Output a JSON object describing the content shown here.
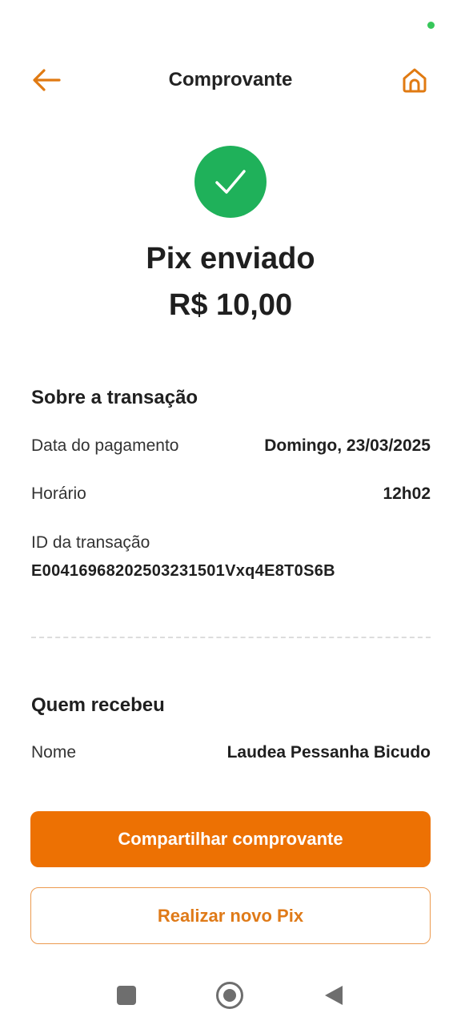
{
  "header": {
    "title": "Comprovante",
    "back_icon": "arrow-left-icon",
    "home_icon": "home-icon"
  },
  "status": {
    "icon": "check-icon",
    "title": "Pix enviado",
    "amount": "R$ 10,00"
  },
  "transaction": {
    "section_title": "Sobre a transação",
    "date_label": "Data do pagamento",
    "date_value": "Domingo, 23/03/2025",
    "time_label": "Horário",
    "time_value": "12h02",
    "id_label": "ID da transação",
    "id_value": "E00416968202503231501Vxq4E8T0S6B"
  },
  "recipient": {
    "section_title": "Quem recebeu",
    "name_label": "Nome",
    "name_value": "Laudea Pessanha Bicudo"
  },
  "actions": {
    "share_label": "Compartilhar comprovante",
    "new_pix_label": "Realizar novo Pix"
  },
  "colors": {
    "accent": "#ed7103",
    "success": "#1fb15a",
    "status_dot": "#37c75a"
  },
  "system_nav": {
    "recents_icon": "square-icon",
    "home_icon": "circle-home-icon",
    "back_icon": "triangle-back-icon"
  }
}
